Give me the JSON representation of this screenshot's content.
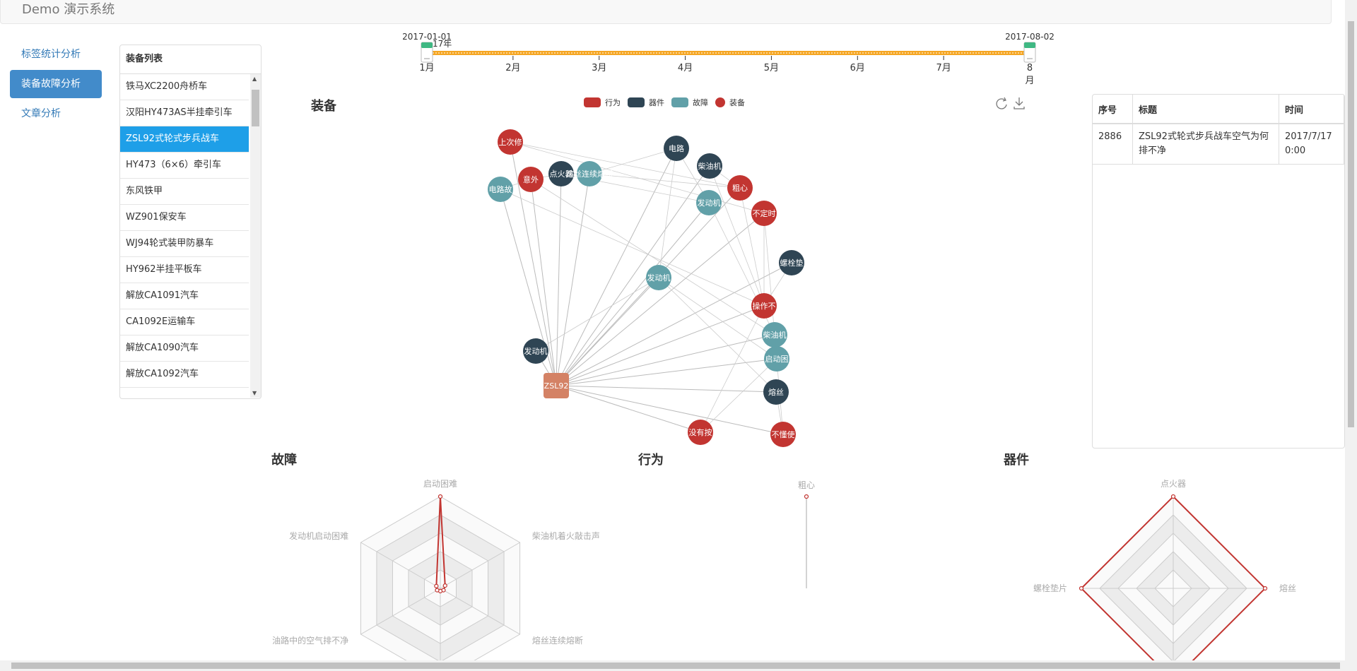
{
  "app": {
    "title": "Demo 演示系统"
  },
  "sidebar": {
    "items": [
      {
        "label": "标签统计分析",
        "active": false
      },
      {
        "label": "装备故障分析",
        "active": true
      },
      {
        "label": "文章分析",
        "active": false
      }
    ]
  },
  "equipment": {
    "header": "装备列表",
    "items": [
      "铁马XC2200舟桥车",
      "汉阳HY473AS半挂牵引车",
      "ZSL92式轮式步兵战车",
      "HY473（6×6）牵引车",
      "东风铁甲",
      "WZ901保安车",
      "WJ94轮式装甲防暴车",
      "HY962半挂平板车",
      "解放CA1091汽车",
      "CA1092E运输车",
      "解放CA1090汽车",
      "解放CA1092汽车"
    ],
    "selected_index": 2
  },
  "timeline": {
    "start_label": "2017-01-01",
    "end_label": "2017-08-02",
    "year_label": "17年",
    "months": [
      "1月",
      "2月",
      "3月",
      "4月",
      "5月",
      "6月",
      "7月",
      "8月"
    ],
    "start_handle": "1月",
    "end_handle": "8月",
    "track_color": "#f5a623"
  },
  "graph": {
    "title": "装备",
    "legend": [
      {
        "name": "行为",
        "color": "#c23531"
      },
      {
        "name": "器件",
        "color": "#2f4554"
      },
      {
        "name": "故障",
        "color": "#61a0a8"
      },
      {
        "name": "装备",
        "color": "#c23531"
      }
    ],
    "center": {
      "label": "ZSL92",
      "color": "#d48265"
    },
    "nodes": [
      {
        "label": "上次修",
        "category": "行为"
      },
      {
        "label": "电路故",
        "category": "故障"
      },
      {
        "label": "意外",
        "category": "行为"
      },
      {
        "label": "点火器",
        "category": "器件"
      },
      {
        "label": "熔丝连续熔断",
        "category": "故障"
      },
      {
        "label": "电路",
        "category": "器件"
      },
      {
        "label": "柴油机",
        "category": "器件"
      },
      {
        "label": "粗心",
        "category": "行为"
      },
      {
        "label": "发动机",
        "category": "故障"
      },
      {
        "label": "不定时",
        "category": "行为"
      },
      {
        "label": "螺栓垫",
        "category": "器件"
      },
      {
        "label": "发动机",
        "category": "故障"
      },
      {
        "label": "操作不",
        "category": "行为"
      },
      {
        "label": "柴油机",
        "category": "故障"
      },
      {
        "label": "启动困",
        "category": "故障"
      },
      {
        "label": "发动机",
        "category": "器件"
      },
      {
        "label": "熔丝",
        "category": "器件"
      },
      {
        "label": "没有按",
        "category": "行为"
      },
      {
        "label": "不懂使",
        "category": "行为"
      }
    ],
    "toolbox": [
      "refresh-icon",
      "download-icon"
    ]
  },
  "records": {
    "columns": [
      "序号",
      "标题",
      "时间"
    ],
    "rows": [
      {
        "id": "2886",
        "title": "ZSL92式轮式步兵战车空气为何排不净",
        "time": "2017/7/17 0:00"
      }
    ]
  },
  "radars": [
    {
      "title": "故障",
      "indicators": [
        "启动困难",
        "柴油机着火敲击声",
        "熔丝连续熔断",
        "",
        "油路中的空气排不净",
        "发动机启动困难"
      ],
      "values": [
        1,
        0.06,
        0.04,
        0.03,
        0.04,
        0.05
      ],
      "line_color": "#c23531"
    },
    {
      "title": "行为",
      "indicators": [
        "粗心"
      ],
      "values": [
        1
      ],
      "line_color": "#c23531"
    },
    {
      "title": "器件",
      "indicators": [
        "点火器",
        "熔丝",
        "",
        "螺栓垫片"
      ],
      "values": [
        1,
        1,
        1,
        1
      ],
      "line_color": "#c23531"
    }
  ]
}
